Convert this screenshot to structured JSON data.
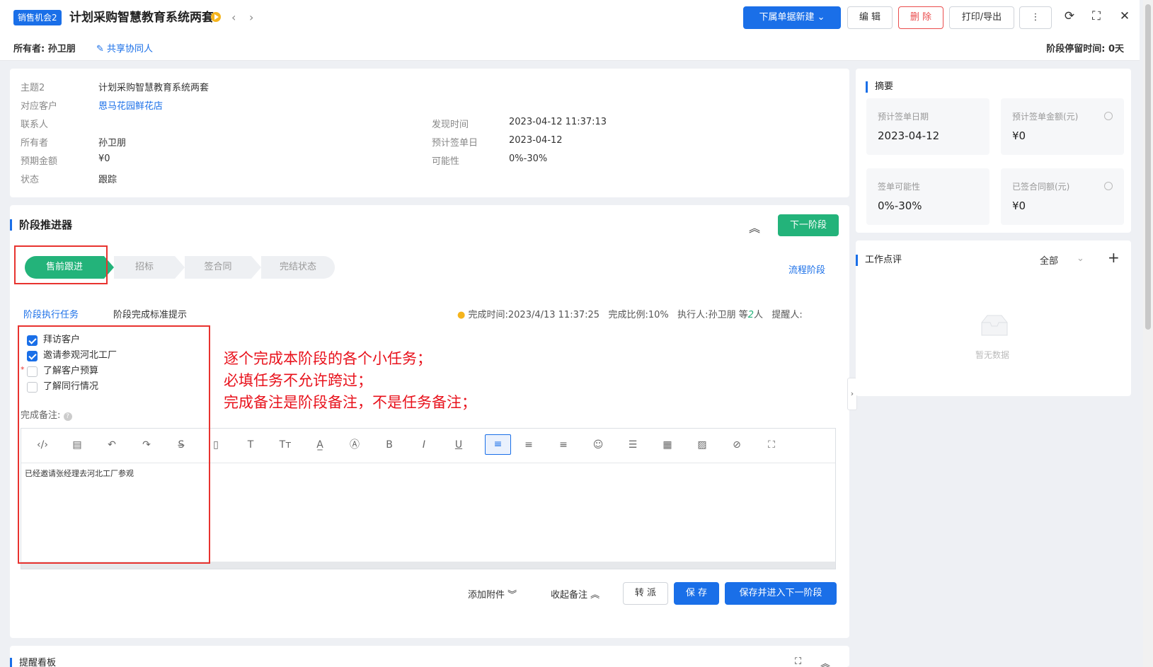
{
  "header": {
    "tag": "销售机会2",
    "title": "计划采购智慧教育系统两套",
    "prev_icon": "chevron-left-icon",
    "next_icon": "chevron-right-icon",
    "btn_new": "下属单据新建",
    "btn_edit": "编 辑",
    "btn_delete": "删 除",
    "btn_print": "打印/导出",
    "btn_more": "⋮",
    "owner_label": "所有者:",
    "owner_name": "孙卫朋",
    "share": "共享协同人",
    "stay_label": "阶段停留时间:",
    "stay_value": "0天"
  },
  "info": {
    "subject_label": "主题2",
    "subject": "计划采购智慧教育系统两套",
    "customer_label": "对应客户",
    "customer": "恩马花园鲜花店",
    "contact_label": "联系人",
    "contact": "",
    "owner_label": "所有者",
    "owner": "孙卫朋",
    "amount_label": "预期金额",
    "amount": "¥0",
    "status_label": "状态",
    "status": "跟踪",
    "found_label": "发现时间",
    "found": "2023-04-12 11:37:13",
    "sign_label": "预计签单日",
    "sign": "2023-04-12",
    "prob_label": "可能性",
    "prob": "0%-30%"
  },
  "stage": {
    "title": "阶段推进器",
    "next_btn": "下一阶段",
    "steps": [
      "售前跟进",
      "招标",
      "签合同",
      "完结状态"
    ],
    "flow_link": "流程阶段",
    "tab_tasks": "阶段执行任务",
    "tab_hint": "阶段完成标准提示",
    "meta_time_label": "完成时间:",
    "meta_time": "2023/4/13 11:37:25",
    "meta_ratio_label": "完成比例:",
    "meta_ratio": "10%",
    "meta_exec_label": "执行人:",
    "meta_exec": "孙卫朋 等",
    "meta_exec_count": "2",
    "meta_exec_suffix": "人",
    "meta_remind_label": "提醒人:",
    "tasks": [
      {
        "label": "拜访客户",
        "checked": true,
        "required": false
      },
      {
        "label": "邀请参观河北工厂",
        "checked": true,
        "required": false
      },
      {
        "label": "了解客户预算",
        "checked": false,
        "required": true
      },
      {
        "label": "了解同行情况",
        "checked": false,
        "required": false
      }
    ],
    "note_label": "完成备注:",
    "note_text": "已经邀请张经理去河北工厂参观",
    "attach": "添加附件",
    "collapse_note": "收起备注",
    "btn_transfer": "转 派",
    "btn_save": "保 存",
    "btn_save_next": "保存并进入下一阶段"
  },
  "annotation": {
    "line1": "逐个完成本阶段的各个小任务；",
    "line2": "必填任务不允许跨过；",
    "line3": "完成备注是阶段备注，不是任务备注；"
  },
  "summary": {
    "title": "摘要",
    "sign_date_label": "预计签单日期",
    "sign_date": "2023-04-12",
    "sign_amount_label": "预计签单金额(元)",
    "sign_amount": "¥0",
    "prob_label": "签单可能性",
    "prob": "0%-30%",
    "contract_label": "已签合同额(元)",
    "contract": "¥0"
  },
  "review": {
    "title": "工作点评",
    "filter": "全部",
    "empty": "暂无数据"
  },
  "reminder": {
    "title": "提醒看板"
  },
  "toolbar_icons": [
    "code-icon",
    "template-icon",
    "undo-icon",
    "redo-icon",
    "strikethrough-icon",
    "paste-icon",
    "font-size-icon",
    "font-family-icon",
    "font-color-icon",
    "bg-color-icon",
    "bold-icon",
    "italic-icon",
    "underline-icon",
    "align-left-icon",
    "align-center-icon",
    "align-right-icon",
    "emoji-icon",
    "line-height-icon",
    "table-icon",
    "image-icon",
    "attachment-icon",
    "fullscreen-icon"
  ]
}
